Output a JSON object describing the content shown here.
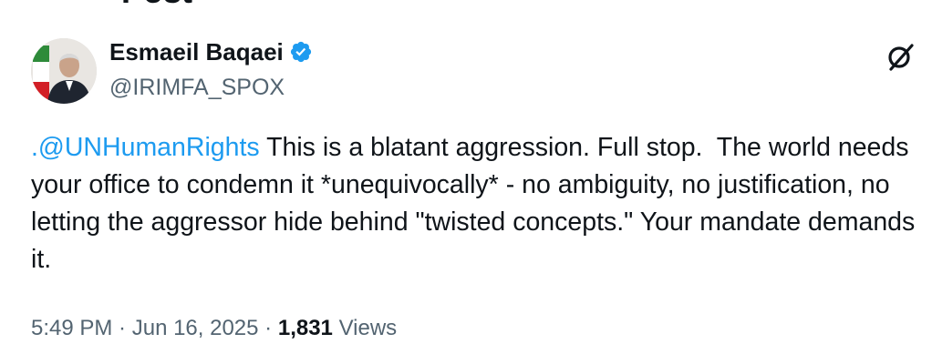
{
  "page": {
    "header_title": "Post"
  },
  "author": {
    "name": "Esmaeil Baqaei",
    "handle": "@IRIMFA_SPOX",
    "verified": true,
    "avatar_icon": "profile-photo-with-flag"
  },
  "tweet": {
    "mention": ".@UNHumanRights",
    "text": " This is a blatant aggression. Full stop.  The world needs your office to condemn it *unequivocally* - no ambiguity, no justification, no letting the aggressor hide behind \"twisted concepts.\" Your mandate demands it."
  },
  "meta": {
    "time": "5:49 PM",
    "separator1": " · ",
    "date": "Jun 16, 2025",
    "separator2": " · ",
    "views_count": "1,831",
    "views_label": " Views"
  },
  "icons": {
    "grok": "grok-icon",
    "verified": "verified-badge-icon"
  },
  "colors": {
    "link": "#1d9bf0",
    "secondary_text": "#536471",
    "primary_text": "#0f1419",
    "verified_blue": "#1d9bf0"
  }
}
